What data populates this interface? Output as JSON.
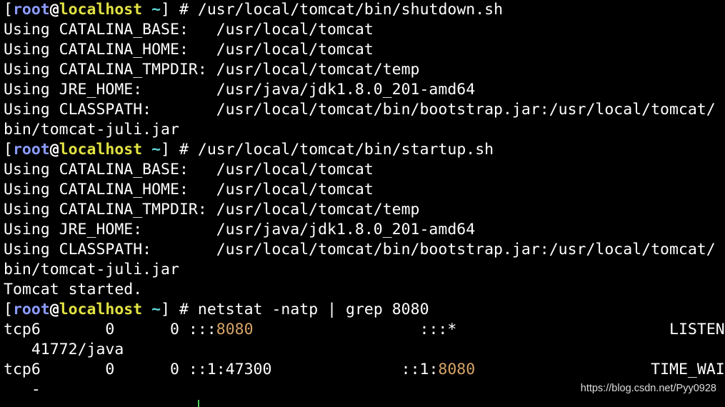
{
  "prompt": {
    "open": "[",
    "user": "root",
    "at": "@",
    "host": "localhost",
    "dir": "~",
    "close": "]",
    "symbol": "#"
  },
  "commands": {
    "shutdown": "/usr/local/tomcat/bin/shutdown.sh",
    "startup": "/usr/local/tomcat/bin/startup.sh",
    "netstat": "netstat -natp | grep 8080"
  },
  "env_output": [
    "Using CATALINA_BASE:   /usr/local/tomcat",
    "Using CATALINA_HOME:   /usr/local/tomcat",
    "Using CATALINA_TMPDIR: /usr/local/tomcat/temp",
    "Using JRE_HOME:        /usr/java/jdk1.8.0_201-amd64",
    "Using CLASSPATH:       /usr/local/tomcat/bin/bootstrap.jar:/usr/local/tomcat/",
    "bin/tomcat-juli.jar"
  ],
  "started_message": "Tomcat started.",
  "netstat_rows": [
    {
      "proto": "tcp6",
      "recv_q": "0",
      "send_q": "0",
      "local_prefix": ":::",
      "local_port": "8080",
      "foreign_prefix": ":::*",
      "foreign_port": "",
      "state": "LISTEN",
      "pid_program": "41772/java"
    },
    {
      "proto": "tcp6",
      "recv_q": "0",
      "send_q": "0",
      "local_prefix": "::1:47300",
      "local_port": "",
      "foreign_prefix": "::1:",
      "foreign_port": "8080",
      "state": "TIME_WAIT",
      "pid_program": "-"
    }
  ],
  "watermark": "https://blog.csdn.net/Pyy0928",
  "colors": {
    "background": "#000000",
    "text": "#ffffff",
    "user": "#8c9bff",
    "host": "#e2e243",
    "dir": "#5fd7d7",
    "port_highlight": "#d7a46a",
    "cursor": "#4fcf5f"
  }
}
